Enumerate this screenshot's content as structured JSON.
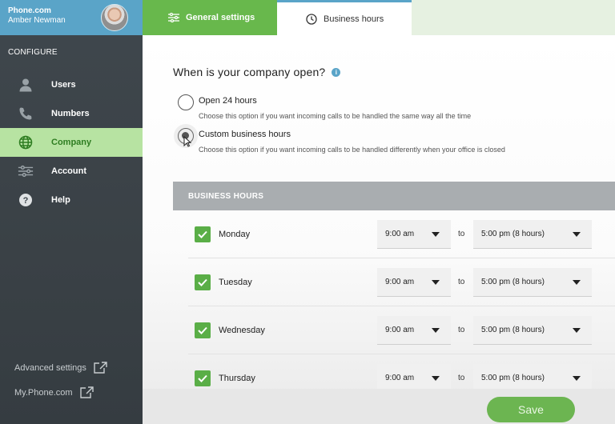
{
  "sidebar": {
    "brand": "Phone.com",
    "user_name": "Amber Newman",
    "section_label": "CONFIGURE",
    "items": [
      {
        "label": "Users",
        "icon": "user-icon",
        "active": false
      },
      {
        "label": "Numbers",
        "icon": "phone-icon",
        "active": false
      },
      {
        "label": "Company",
        "icon": "globe-icon",
        "active": true
      },
      {
        "label": "Account",
        "icon": "sliders-icon",
        "active": false
      },
      {
        "label": "Help",
        "icon": "help-icon",
        "active": false
      }
    ],
    "footer_links": [
      {
        "label": "Advanced settings",
        "icon": "external-link-icon"
      },
      {
        "label": "My.Phone.com",
        "icon": "external-link-icon"
      }
    ]
  },
  "tabs": [
    {
      "label": "General settings",
      "icon": "settings-sliders-icon",
      "active": false
    },
    {
      "label": "Business hours",
      "icon": "clock-icon",
      "active": true
    }
  ],
  "main": {
    "question": "When is your company open?",
    "options": [
      {
        "title": "Open 24 hours",
        "description": "Choose this option if you want incoming calls to be handled the same way all the time",
        "selected": false
      },
      {
        "title": "Custom business hours",
        "description": "Choose this option if you want incoming calls to be handled differently when your office is closed",
        "selected": true
      }
    ],
    "business_hours_header": "BUSINESS HOURS",
    "to_label": "to",
    "days": [
      {
        "day": "Monday",
        "checked": true,
        "from": "9:00 am",
        "to": "5:00 pm (8 hours)"
      },
      {
        "day": "Tuesday",
        "checked": true,
        "from": "9:00 am",
        "to": "5:00 pm (8 hours)"
      },
      {
        "day": "Wednesday",
        "checked": true,
        "from": "9:00 am",
        "to": "5:00 pm (8 hours)"
      },
      {
        "day": "Thursday",
        "checked": true,
        "from": "9:00 am",
        "to": "5:00 pm (8 hours)"
      }
    ],
    "save_label": "Save"
  },
  "colors": {
    "green": "#68b84c",
    "blue": "#5aa4c8",
    "sidebar_bg": "#3f474d",
    "active_item": "#b7e3a2"
  }
}
